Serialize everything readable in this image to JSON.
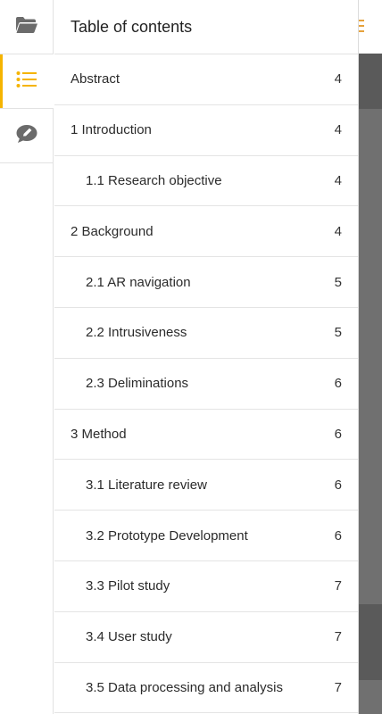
{
  "header": {
    "title": "Table of contents"
  },
  "rail": {
    "items": [
      {
        "icon": "folder-open-icon",
        "active": false
      },
      {
        "icon": "list-icon",
        "active": true
      },
      {
        "icon": "comment-edit-icon",
        "active": false
      }
    ]
  },
  "colors": {
    "accent": "#f5b400",
    "overlay": "#707070"
  },
  "toc": [
    {
      "label": "Abstract",
      "page": "4",
      "level": 0
    },
    {
      "label": "1 Introduction",
      "page": "4",
      "level": 0
    },
    {
      "label": "1.1 Research objective",
      "page": "4",
      "level": 1
    },
    {
      "label": "2 Background",
      "page": "4",
      "level": 0
    },
    {
      "label": "2.1 AR navigation",
      "page": "5",
      "level": 1
    },
    {
      "label": "2.2 Intrusiveness",
      "page": "5",
      "level": 1
    },
    {
      "label": "2.3 Deliminations",
      "page": "6",
      "level": 1
    },
    {
      "label": "3 Method",
      "page": "6",
      "level": 0
    },
    {
      "label": "3.1 Literature review",
      "page": "6",
      "level": 1
    },
    {
      "label": "3.2 Prototype Development",
      "page": "6",
      "level": 1
    },
    {
      "label": "3.3 Pilot study",
      "page": "7",
      "level": 1
    },
    {
      "label": "3.4 User study",
      "page": "7",
      "level": 1
    },
    {
      "label": "3.5 Data processing and analysis",
      "page": "7",
      "level": 1
    }
  ]
}
